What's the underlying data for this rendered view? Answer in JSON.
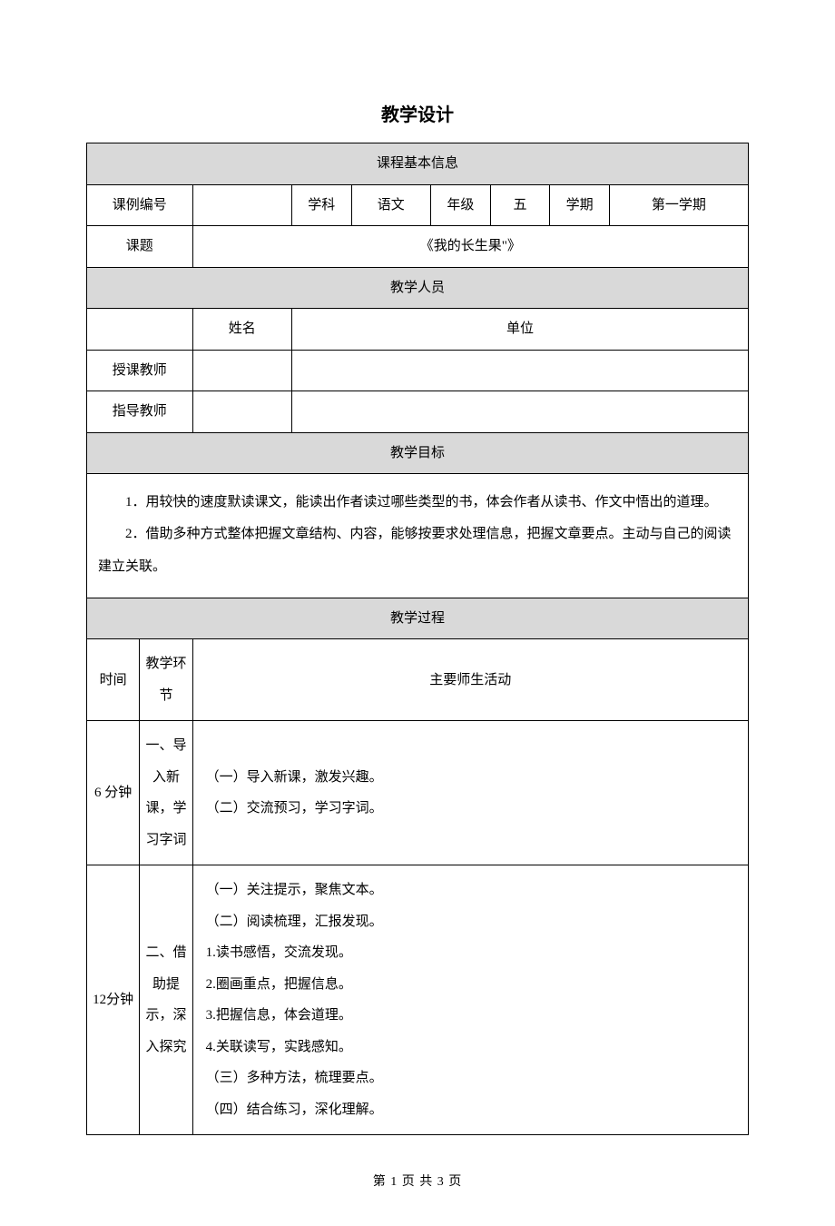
{
  "title": "教学设计",
  "sections": {
    "basic_info": "课程基本信息",
    "teaching_staff": "教学人员",
    "teaching_goals": "教学目标",
    "teaching_process": "教学过程"
  },
  "labels": {
    "lesson_id": "课例编号",
    "subject": "学科",
    "grade": "年级",
    "semester": "学期",
    "topic": "课题",
    "name": "姓名",
    "unit": "单位",
    "teacher": "授课教师",
    "advisor": "指导教师",
    "time": "时间",
    "segment": "教学环节",
    "activities": "主要师生活动"
  },
  "values": {
    "lesson_id": "",
    "subject": "语文",
    "grade": "五",
    "semester": "第一学期",
    "topic": "《我的长生果\"》",
    "teacher_name": "",
    "teacher_unit": "",
    "advisor_name": "",
    "advisor_unit": ""
  },
  "goals": {
    "item1": "1．用较快的速度默读课文，能读出作者读过哪些类型的书，体会作者从读书、作文中悟出的道理。",
    "item2": "2．借助多种方式整体把握文章结构、内容，能够按要求处理信息，把握文章要点。主动与自己的阅读建立关联。"
  },
  "process": {
    "row1": {
      "time": "6 分钟",
      "segment": "一、导入新课，学习字词",
      "line1": "（一）导入新课，激发兴趣。",
      "line2": "（二）交流预习，学习字词。"
    },
    "row2": {
      "time": "12分钟",
      "segment": "二、借助提示，深入探究",
      "line1": "（一）关注提示，聚焦文本。",
      "line2": "（二）阅读梳理，汇报发现。",
      "line3": "1.读书感悟，交流发现。",
      "line4": "2.圈画重点，把握信息。",
      "line5": "3.把握信息，体会道理。",
      "line6": "4.关联读写，实践感知。",
      "line7": "（三）多种方法，梳理要点。",
      "line8": "（四）结合练习，深化理解。"
    }
  },
  "footer": "第 1 页 共 3 页"
}
